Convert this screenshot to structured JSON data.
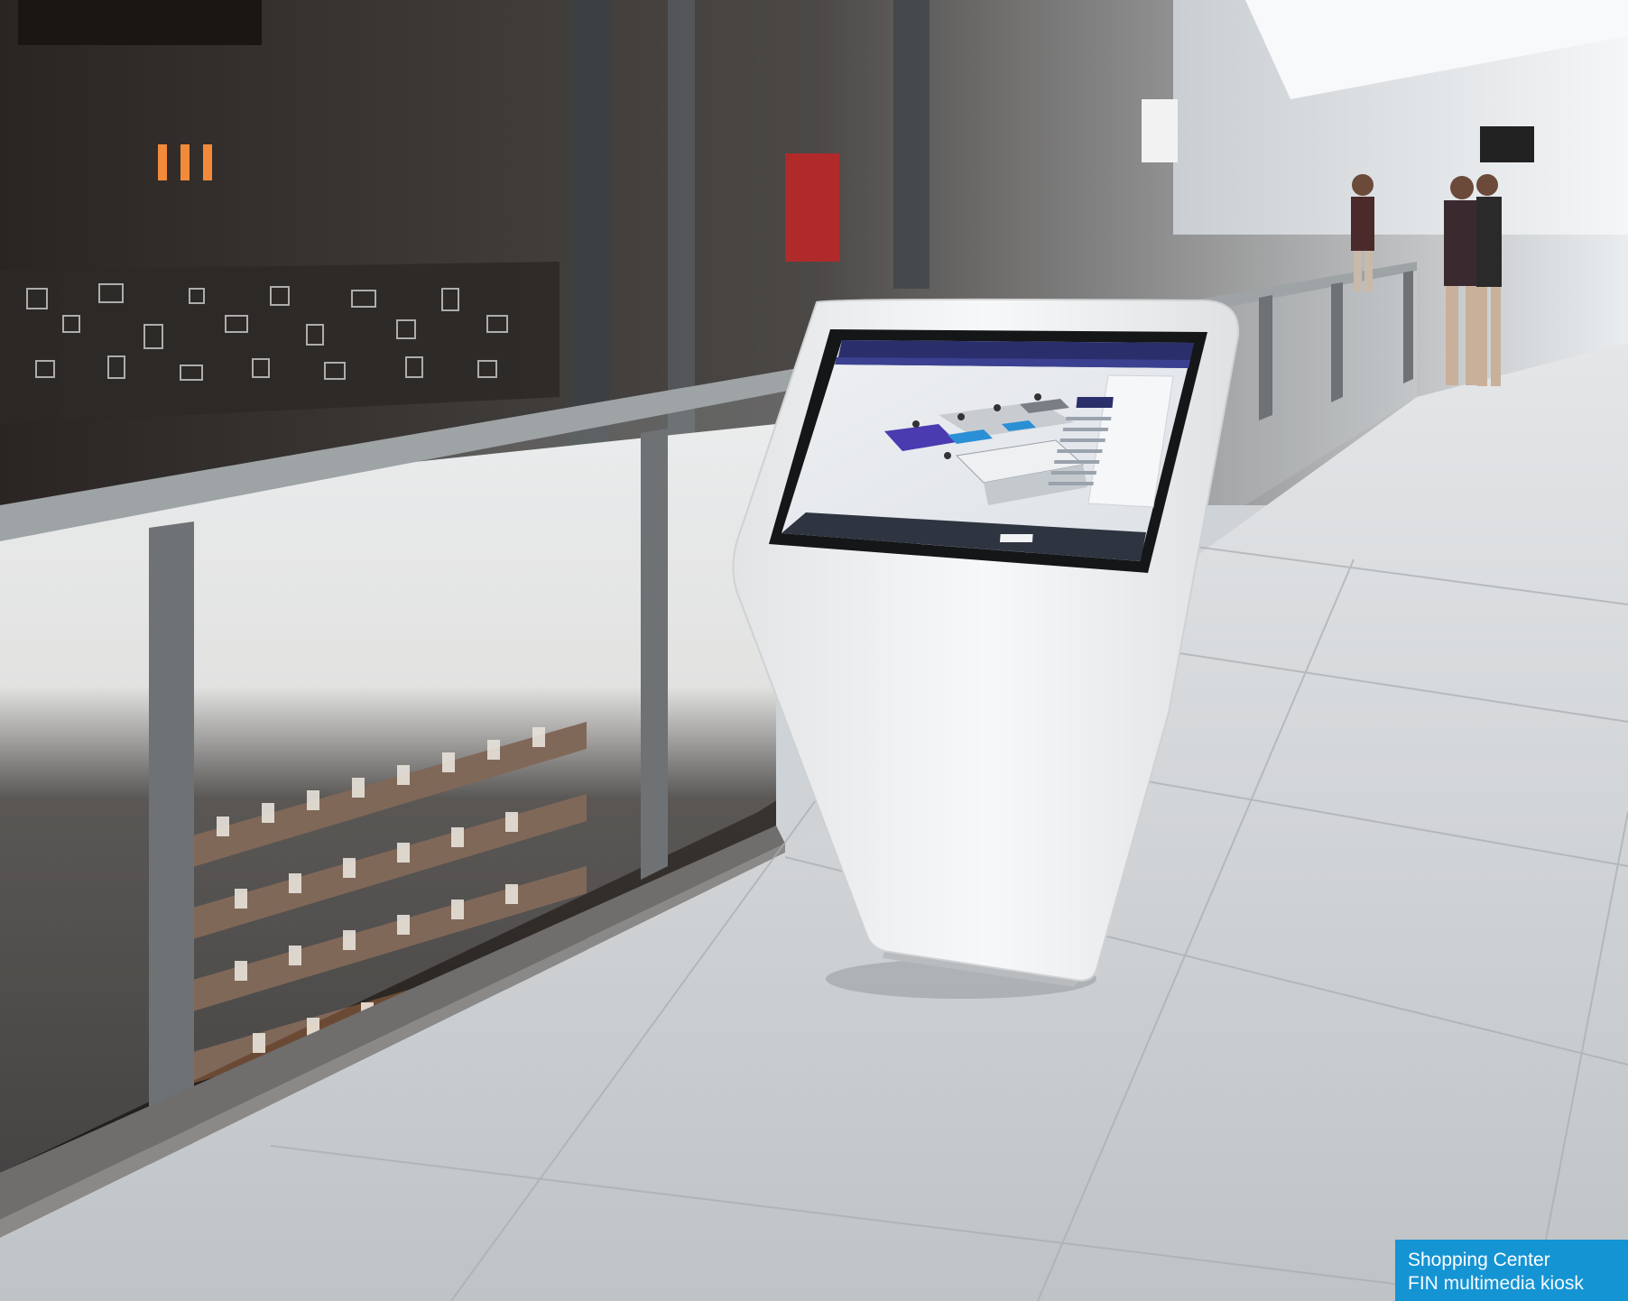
{
  "scene": {
    "description_hidden": "",
    "colors": {
      "floor": "#d9dcde",
      "kiosk": "#f3f4f5",
      "screen_bezel": "#141618",
      "nav_bar": "#2a2f6b",
      "accent_purple": "#4a3bb0",
      "accent_blue": "#2b8fd6"
    }
  },
  "caption": {
    "title": "Shopping Center",
    "subtitle": "FIN multimedia kiosk",
    "background": "#1594d4"
  }
}
